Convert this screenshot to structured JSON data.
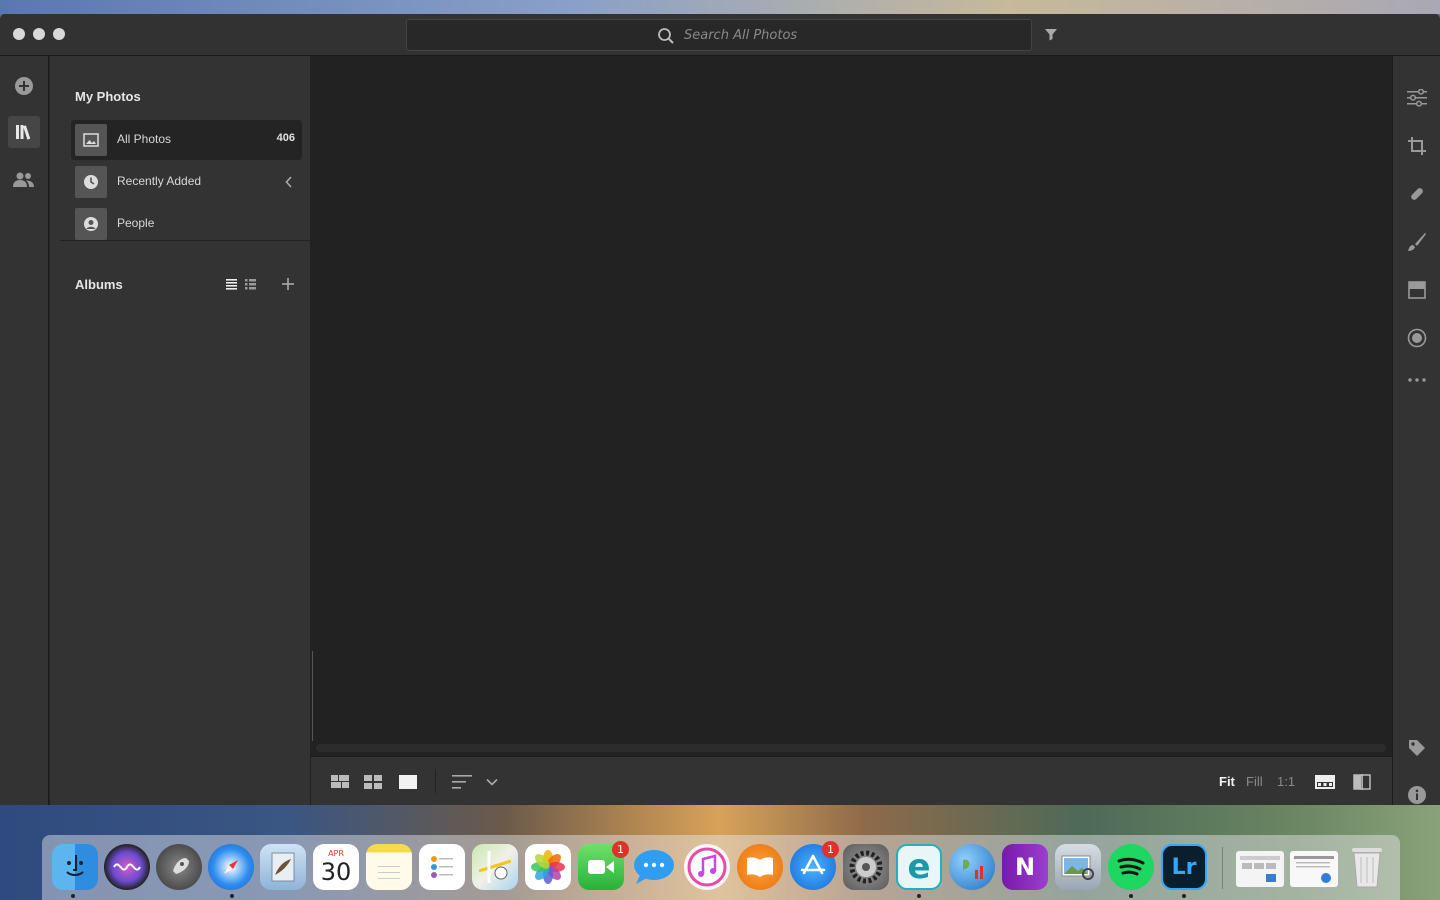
{
  "titlebar": {
    "search_placeholder": "Search All Photos"
  },
  "rail": {
    "items": [
      {
        "icon": "add-photos-icon"
      },
      {
        "icon": "library-icon",
        "active": true
      },
      {
        "icon": "people-sharing-icon"
      }
    ]
  },
  "sidebar": {
    "my_photos_title": "My Photos",
    "items": [
      {
        "label": "All Photos",
        "count": "406",
        "icon": "photo-icon",
        "selected": true
      },
      {
        "label": "Recently Added",
        "icon": "clock-icon"
      },
      {
        "label": "People",
        "icon": "person-icon"
      }
    ],
    "albums_title": "Albums"
  },
  "bottombar": {
    "zoom_options": [
      "Fit",
      "Fill",
      "1:1"
    ],
    "active_zoom": "Fit"
  },
  "tools": {
    "items": [
      "edit-sliders-icon",
      "crop-icon",
      "healing-icon",
      "brush-icon",
      "linear-gradient-icon",
      "radial-gradient-icon",
      "more-icon",
      "keyword-tag-icon",
      "info-icon"
    ]
  },
  "dock": {
    "apps": [
      {
        "name": "Finder",
        "running": true
      },
      {
        "name": "Siri"
      },
      {
        "name": "Launchpad"
      },
      {
        "name": "Safari",
        "running": true
      },
      {
        "name": "Mail"
      },
      {
        "name": "Calendar",
        "month": "APR",
        "day": "30"
      },
      {
        "name": "Notes"
      },
      {
        "name": "Reminders"
      },
      {
        "name": "Maps"
      },
      {
        "name": "Photos"
      },
      {
        "name": "FaceTime",
        "badge": "1"
      },
      {
        "name": "Messages"
      },
      {
        "name": "iTunes"
      },
      {
        "name": "Books"
      },
      {
        "name": "App Store",
        "badge": "1"
      },
      {
        "name": "System Preferences"
      },
      {
        "name": "Eset",
        "running": true
      },
      {
        "name": "Network Radar"
      },
      {
        "name": "OneNote"
      },
      {
        "name": "Preview"
      },
      {
        "name": "Spotify",
        "running": true
      },
      {
        "name": "Lightroom",
        "running": true,
        "label": "Lr"
      }
    ],
    "colors": {
      "accent": "#31a8ff",
      "badge": "#e2302c"
    }
  }
}
